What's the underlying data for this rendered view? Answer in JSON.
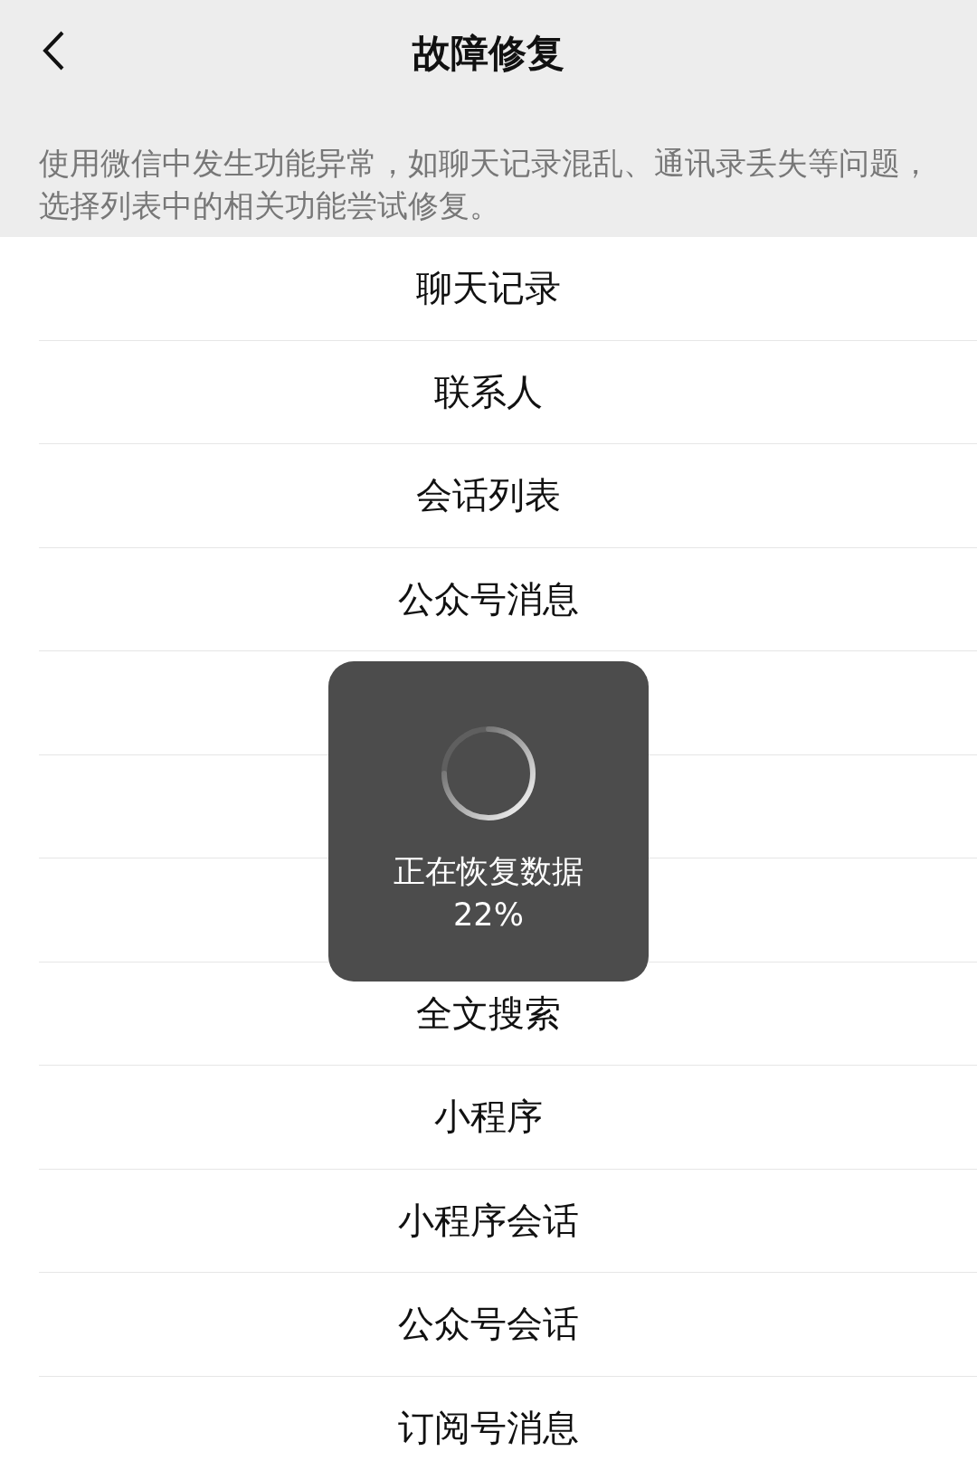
{
  "header": {
    "title": "故障修复",
    "description": "使用微信中发生功能异常，如聊天记录混乱、通讯录丢失等问题，选择列表中的相关功能尝试修复。"
  },
  "list_top": [
    "聊天记录",
    "联系人",
    "会话列表",
    "公众号消息"
  ],
  "list_bottom": [
    "全文搜索",
    "小程序",
    "小程序会话",
    "公众号会话",
    "订阅号消息"
  ],
  "toast": {
    "message": "正在恢复数据",
    "progress": "22%"
  }
}
